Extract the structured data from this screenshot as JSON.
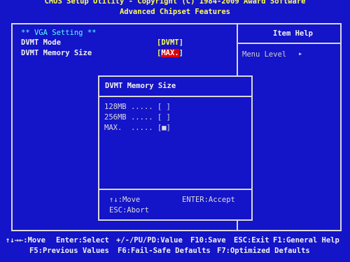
{
  "header": {
    "line1": "CMOS Setup Utility - Copyright (C) 1984-2009 Award Software",
    "line2": "Advanced Chipset Features"
  },
  "settings": {
    "section_label": "** VGA Setting **",
    "dvmt_mode_label": "DVMT Mode",
    "dvmt_mode_value": "[DVMT]",
    "dvmt_memory_label": "DVMT Memory Size",
    "dvmt_memory_value_open": "[",
    "dvmt_memory_value": "MAX.",
    "dvmt_memory_value_close": "]"
  },
  "help_panel": {
    "title": "Item Help",
    "menu_level_label": "Menu Level",
    "menu_level_arrow": "▸"
  },
  "popup": {
    "title": "DVMT Memory Size",
    "options": [
      {
        "label": "128MB",
        "dots": ".....",
        "mark": "[ ]"
      },
      {
        "label": "256MB",
        "dots": ".....",
        "mark": "[ ]"
      },
      {
        "label": "MAX.",
        "dots": ".....",
        "mark": "[■]"
      }
    ],
    "hint_move": "↑↓:Move",
    "hint_accept": "ENTER:Accept",
    "hint_abort": "ESC:Abort"
  },
  "footer": {
    "move": "↑↓→←:Move",
    "enter": "Enter:Select",
    "value": "+/-/PU/PD:Value",
    "save": "F10:Save",
    "exit": "ESC:Exit",
    "help": "F1:General Help",
    "prev": "F5:Previous Values",
    "failsafe": "F6:Fail-Safe Defaults",
    "optimized": "F7:Optimized Defaults"
  },
  "colors": {
    "background": "#1414c8",
    "header_text": "#ffff55",
    "section_text": "#55ffff",
    "selected_bg": "#e00000"
  }
}
